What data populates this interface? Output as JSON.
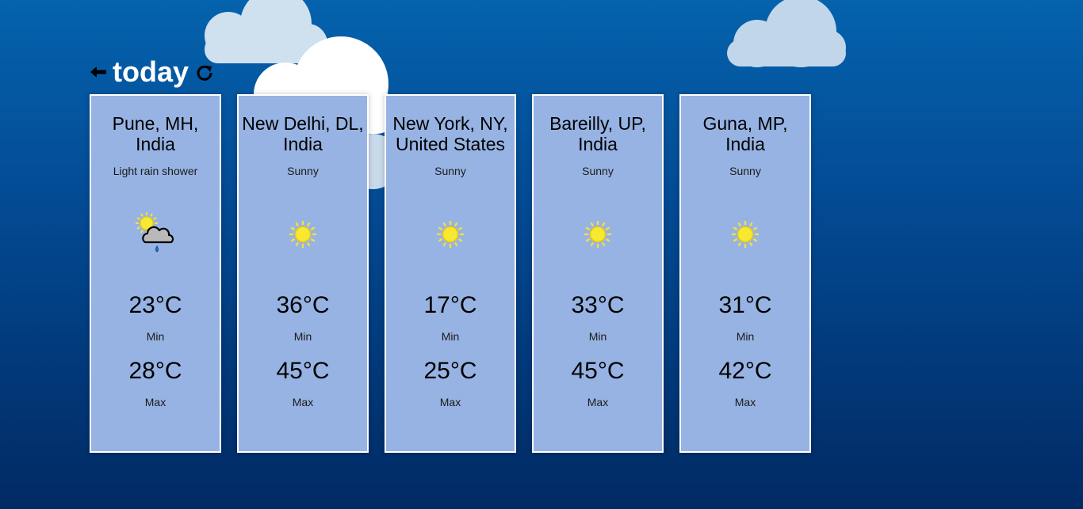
{
  "header": {
    "title": "today",
    "back_icon": "arrow-left-icon",
    "refresh_icon": "refresh-icon"
  },
  "colors": {
    "background_top": "#0562ad",
    "background_bottom": "#012a64",
    "card": "#97b3e3",
    "card_border": "#ffffff"
  },
  "cities": [
    {
      "name_line1": "Pune, MH,",
      "name_line2": "India",
      "condition": "Light rain shower",
      "icon": "sun-cloud-rain-icon",
      "min_temp": "23°C",
      "min_label": "Min",
      "max_temp": "28°C",
      "max_label": "Max"
    },
    {
      "name_line1": "New Delhi, DL,",
      "name_line2": "India",
      "condition": "Sunny",
      "icon": "sun-icon",
      "min_temp": "36°C",
      "min_label": "Min",
      "max_temp": "45°C",
      "max_label": "Max"
    },
    {
      "name_line1": "New York, NY,",
      "name_line2": "United States",
      "condition": "Sunny",
      "icon": "sun-icon",
      "min_temp": "17°C",
      "min_label": "Min",
      "max_temp": "25°C",
      "max_label": "Max"
    },
    {
      "name_line1": "Bareilly, UP,",
      "name_line2": "India",
      "condition": "Sunny",
      "icon": "sun-icon",
      "min_temp": "33°C",
      "min_label": "Min",
      "max_temp": "45°C",
      "max_label": "Max"
    },
    {
      "name_line1": "Guna, MP,",
      "name_line2": "India",
      "condition": "Sunny",
      "icon": "sun-icon",
      "min_temp": "31°C",
      "min_label": "Min",
      "max_temp": "42°C",
      "max_label": "Max"
    }
  ]
}
